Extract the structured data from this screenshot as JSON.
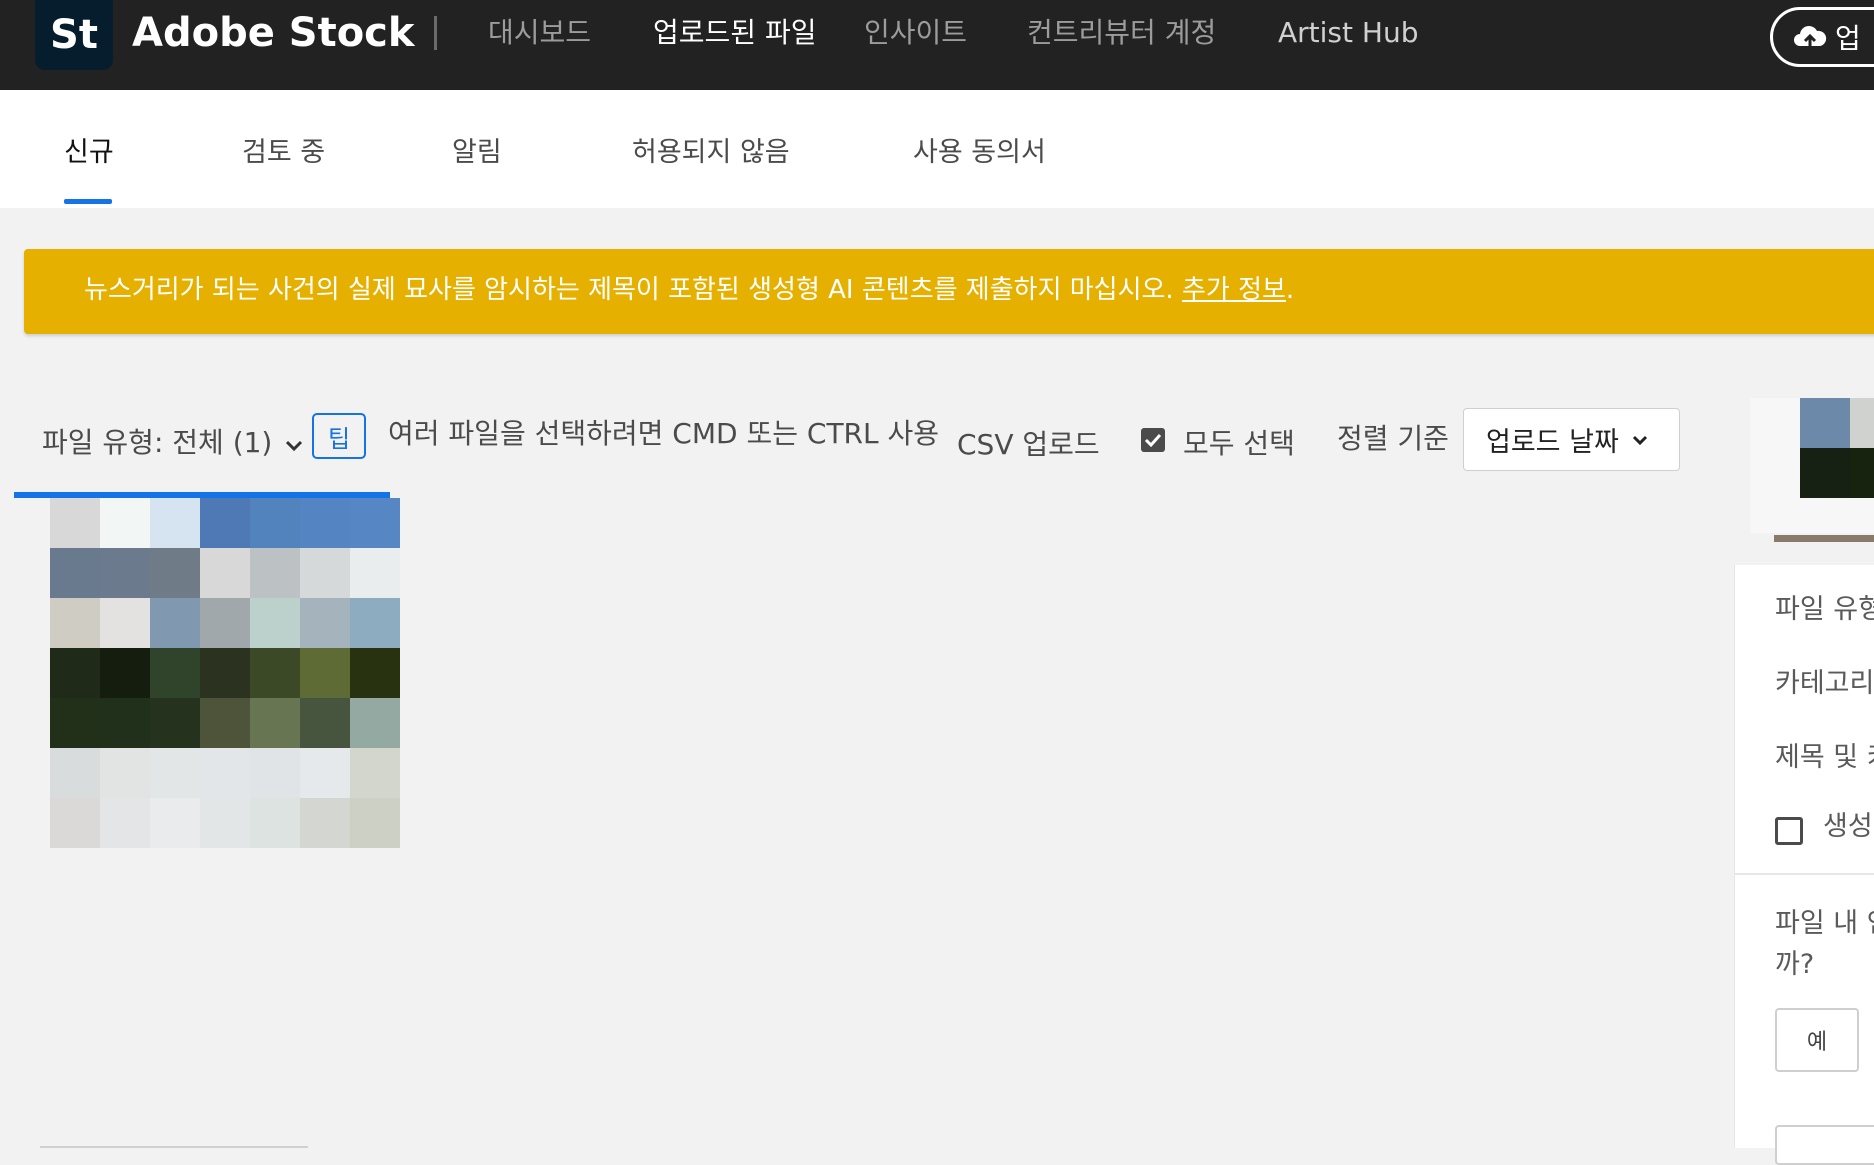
{
  "header": {
    "logo_text": "St",
    "brand": "Adobe Stock",
    "nav": [
      "대시보드",
      "업로드된 파일",
      "인사이트",
      "컨트리뷰터 계정",
      "Artist Hub"
    ],
    "active_nav": "업로드된 파일",
    "upload_label": "업"
  },
  "tabs": {
    "items": [
      "신규",
      "검토 중",
      "알림",
      "허용되지 않음",
      "사용 동의서"
    ],
    "active": "신규"
  },
  "banner": {
    "text": "뉴스거리가 되는 사건의 실제 묘사를 암시하는 제목이 포함된 생성형 AI 콘텐츠를 제출하지 마십시오. ",
    "link": "추가 정보",
    "suffix": ".",
    "color": "#e6b000"
  },
  "toolbar": {
    "file_type": "파일 유형: 전체 (1)",
    "tip_badge": "팁",
    "tip_text": "여러 파일을 선택하려면 CMD 또는 CTRL 사용",
    "csv_upload": "CSV 업로드",
    "select_all": "모두 선택",
    "select_all_checked": true,
    "sort_label": "정렬 기준",
    "sort_value": "업로드 날짜"
  },
  "side_panel": {
    "file_type_label": "파일 유형",
    "category_label": "카테고리",
    "title_keywords_label": "제목 및 키",
    "gen_ai_label": "생성형",
    "question_line1": "파일 내 인",
    "question_line2": "까?",
    "yes_button": "예"
  },
  "colors": {
    "accent": "#1473e6",
    "topbar": "#222222",
    "banner": "#e6b000"
  },
  "icons": [
    "chevron-down-icon",
    "checkbox-checked-icon",
    "cloud-upload-icon",
    "checkbox-empty-icon"
  ]
}
